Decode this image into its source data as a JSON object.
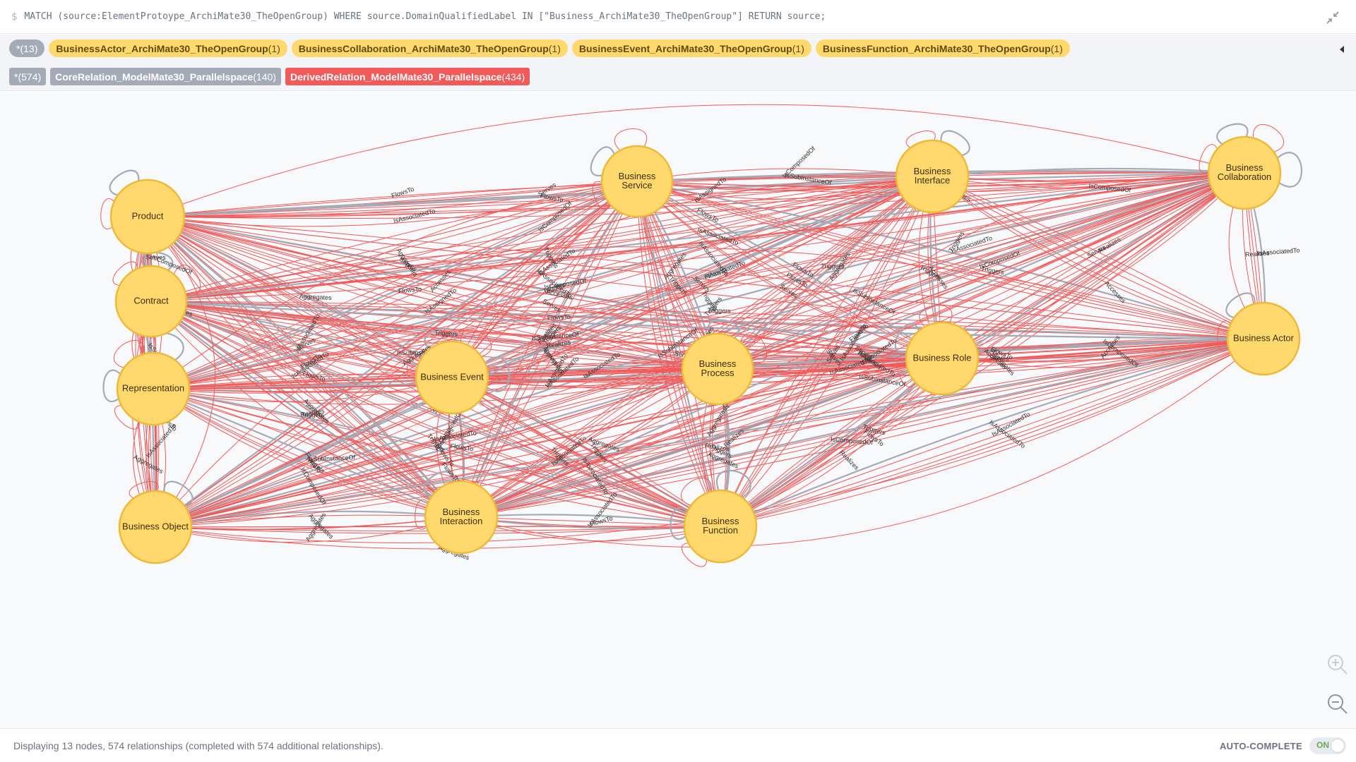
{
  "query": {
    "prompt": "$",
    "text": "MATCH (source:ElementProtoype_ArchiMate30_TheOpenGroup) WHERE source.DomainQualifiedLabel IN [\"Business_ArchiMate30_TheOpenGroup\"] RETURN source;"
  },
  "legend": {
    "node_labels": [
      {
        "label": "*",
        "count": "(13)"
      },
      {
        "label": "BusinessActor_ArchiMate30_TheOpenGroup",
        "count": "(1)"
      },
      {
        "label": "BusinessCollaboration_ArchiMate30_TheOpenGroup",
        "count": "(1)"
      },
      {
        "label": "BusinessEvent_ArchiMate30_TheOpenGroup",
        "count": "(1)"
      },
      {
        "label": "BusinessFunction_ArchiMate30_TheOpenGroup",
        "count": "(1)"
      }
    ],
    "relationship_types": [
      {
        "label": "*",
        "count": "(574)"
      },
      {
        "label": "CoreRelation_ModelMate30_Parallelspace",
        "count": "(140)"
      },
      {
        "label": "DerivedRelation_ModelMate30_Parallelspace",
        "count": "(434)"
      }
    ]
  },
  "graph": {
    "colors": {
      "node_fill": "#ffd86e",
      "node_border": "#edba39",
      "core_edge": "#a5abb6",
      "derived_edge": "#f25a5a"
    },
    "nodes": [
      {
        "id": "product",
        "lines": [
          "Product"
        ]
      },
      {
        "id": "contract",
        "lines": [
          "Contract"
        ]
      },
      {
        "id": "representation",
        "lines": [
          "Representation"
        ]
      },
      {
        "id": "business-object",
        "lines": [
          "Business Object"
        ]
      },
      {
        "id": "business-service",
        "lines": [
          "Business",
          "Service"
        ]
      },
      {
        "id": "business-event",
        "lines": [
          "Business Event"
        ]
      },
      {
        "id": "business-interaction",
        "lines": [
          "Business",
          "Interaction"
        ]
      },
      {
        "id": "business-process",
        "lines": [
          "Business",
          "Process"
        ]
      },
      {
        "id": "business-function",
        "lines": [
          "Business",
          "Function"
        ]
      },
      {
        "id": "business-interface",
        "lines": [
          "Business",
          "Interface"
        ]
      },
      {
        "id": "business-role",
        "lines": [
          "Business Role"
        ]
      },
      {
        "id": "business-collaboration",
        "lines": [
          "Business",
          "Collaboration"
        ]
      },
      {
        "id": "business-actor",
        "lines": [
          "Business Actor"
        ]
      }
    ],
    "edge_labels": [
      "IsComposedOf",
      "Aggregates",
      "IsSubInstanceOf",
      "FlowsTo",
      "Aggregates",
      "IsAssociatedTo",
      "Accesses",
      "Realizes",
      "Serves",
      "Triggers",
      "IsAssignedTo",
      "IsAssociatedTo",
      "Serves",
      "FlowsTo",
      "Aggregates",
      "IsAssociatedTo",
      "Realizes",
      "Triggers",
      "Serves",
      "IsComposedOf",
      "FlowsTo",
      "IsAssociatedTo",
      "Triggers",
      "Serves",
      "Aggregates",
      "IsSubInstanceOf",
      "IsAssociatedTo",
      "FlowsTo",
      "Triggers",
      "Serves",
      "IsComposedOf",
      "Accesses",
      "IsAssociatedTo",
      "FlowsTo",
      "Triggers"
    ]
  },
  "status": {
    "text": "Displaying 13 nodes, 574 relationships (completed with 574 additional relationships).",
    "auto_complete_label": "AUTO-COMPLETE",
    "auto_complete_state": "ON"
  }
}
